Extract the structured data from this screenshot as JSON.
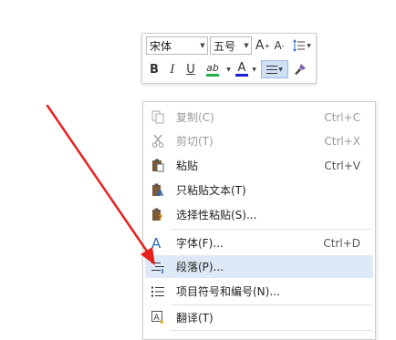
{
  "mini_toolbar": {
    "font_name": "宋体",
    "font_size": "五号",
    "bold_label": "B",
    "italic_label": "I",
    "underline_label": "U",
    "highlight_label": "ab",
    "font_color_label": "A",
    "grow_label": "A",
    "shrink_label": "A",
    "colors": {
      "highlight": "#22b14c",
      "font_color": "#1c1cd6"
    }
  },
  "context_menu": {
    "items": [
      {
        "label": "复制(C)",
        "shortcut": "Ctrl+C",
        "icon": "copy-icon",
        "enabled": false
      },
      {
        "label": "剪切(T)",
        "shortcut": "Ctrl+X",
        "icon": "scissors-icon",
        "enabled": false
      },
      {
        "label": "粘贴",
        "shortcut": "Ctrl+V",
        "icon": "paste-icon",
        "enabled": true
      },
      {
        "label": "只粘贴文本(T)",
        "shortcut": "",
        "icon": "paste-text-icon",
        "enabled": true
      },
      {
        "label": "选择性粘贴(S)...",
        "shortcut": "",
        "icon": "paste-special-icon",
        "enabled": true
      },
      {
        "label": "字体(F)...",
        "shortcut": "Ctrl+D",
        "icon": "font-icon",
        "enabled": true
      },
      {
        "label": "段落(P)...",
        "shortcut": "",
        "icon": "paragraph-icon",
        "enabled": true,
        "highlighted": true
      },
      {
        "label": "项目符号和编号(N)...",
        "shortcut": "",
        "icon": "bullets-icon",
        "enabled": true
      },
      {
        "label": "翻译(T)",
        "shortcut": "",
        "icon": "translate-icon",
        "enabled": true
      }
    ]
  },
  "annotation": {
    "arrow_color": "#e8201c"
  }
}
